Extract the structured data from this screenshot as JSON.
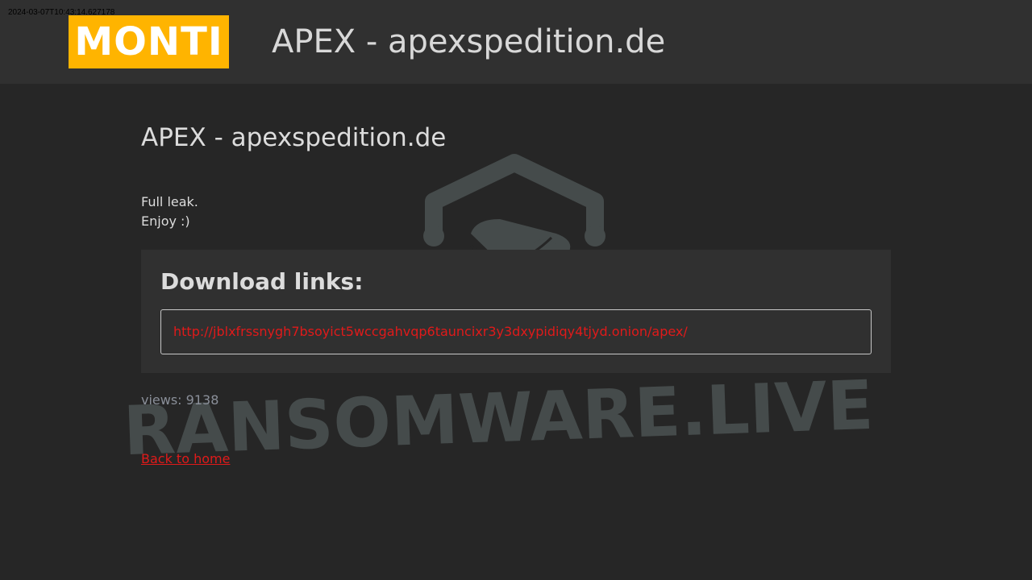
{
  "timestamp": "2024-03-07T10:43:14.627178",
  "header": {
    "logo_text": "MONTI",
    "title": "APEX - apexspedition.de"
  },
  "post": {
    "title": "APEX - apexspedition.de",
    "description_lines": [
      "Full leak.",
      "Enjoy :)"
    ]
  },
  "downloads": {
    "heading": "Download links:",
    "links": [
      "http://jblxfrssnygh7bsoyict5wccgahvqp6tauncixr3y3dxypidiqy4tjyd.onion/apex/"
    ]
  },
  "views": "views: 9138",
  "back_link": "Back to home",
  "watermark": {
    "text": "RANSOMWARE.LIVE",
    "icon": "security-camera-hexagon-icon"
  },
  "colors": {
    "background": "#262626",
    "header_bg": "#303030",
    "logo_bg": "#ffb400",
    "link": "#e01a1a",
    "text": "#dcdcdc",
    "muted": "#8a8f99",
    "watermark": "#454b4b"
  }
}
